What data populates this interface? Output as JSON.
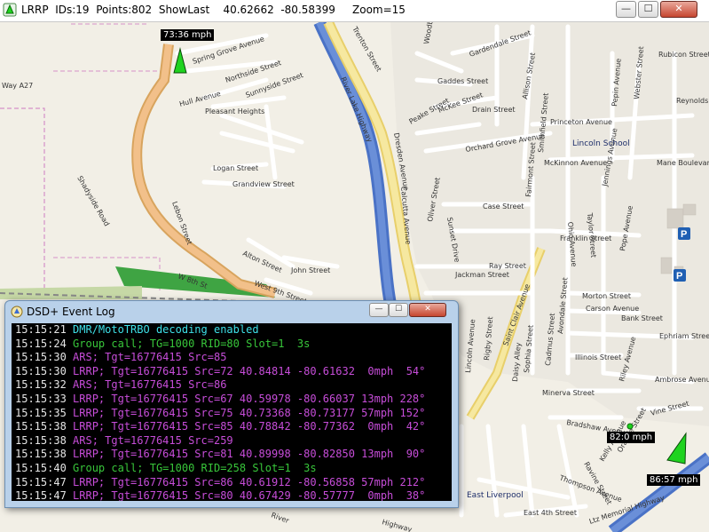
{
  "app": {
    "title": "LRRP  IDs:19  Points:802  ShowLast    40.62662  -80.58399     Zoom=15"
  },
  "titlebar_buttons": {
    "minimize": "—",
    "maximize": "☐",
    "close": "✕"
  },
  "markers": [
    {
      "speed": "73:36 mph",
      "color": "#1fd31f"
    },
    {
      "speed": "82:0 mph",
      "color": "#1fd31f"
    },
    {
      "speed": "86:57 mph",
      "color": "#1fd31f"
    }
  ],
  "map_labels": {
    "streets": [
      "Spring Grove Avenue",
      "Northside Street",
      "Hull Avenue",
      "Sunnyside Street",
      "Pleasant Heights",
      "Logan Street",
      "Grandview Street",
      "Lebon Street",
      "Shadyside Road",
      "Alton Street",
      "John Street",
      "West 9th Street",
      "W 8th St",
      "River Lake Highway",
      "Dresden Avenue",
      "Calcutta Avenue",
      "Trenton Street",
      "Woodbine",
      "Gaddes Street",
      "Gardendale Street",
      "Allison Street",
      "Rubicon Street",
      "Pepin Avenue",
      "Webster Street",
      "Reynolds",
      "Peake Street",
      "McKee Street",
      "Drain Street",
      "Princeton Avenue",
      "Orchard Grove Avenue",
      "Smithfield Street",
      "McKinnon Avenue",
      "Lincoln School",
      "Mane Boulevard",
      "Jennings Avenue",
      "Case Street",
      "Oliver Street",
      "Sunset Drive",
      "Franklin Street",
      "Pope Avenue",
      "Ray Street",
      "Jackman Street",
      "Saint Clair Avenue",
      "Morton Street",
      "Carson Avenue",
      "Bank Street",
      "Ephriam Street",
      "Illinois Street",
      "Minerva Street",
      "Ambrose Avenue",
      "Riley Avenue",
      "Vine Street",
      "Bradshaw Avenue",
      "Lincoln Avenue",
      "Rigby Street",
      "Sophia Street",
      "Daisy Alley",
      "Cadmus Street",
      "Avondale Street",
      "East Liverpool",
      "Ravine Street",
      "Thompson Avenue",
      "East 4th Street",
      "Orange Street",
      "Fairmont Street",
      "Ohio Avenue",
      "Taylor Street",
      "Kelly Avenue",
      "Highway",
      "River"
    ],
    "route": "Way A27",
    "highway_bottom": "Ltz Memorial Highway",
    "parking": "P"
  },
  "event_log": {
    "title": "DSD+ Event Log",
    "lines": [
      {
        "time": "15:15:21",
        "text": "DMR/MotoTRBO decoding enabled",
        "color": "cyan"
      },
      {
        "time": "15:15:24",
        "text": "Group call; TG=1000 RID=80 Slot=1  3s",
        "color": "green"
      },
      {
        "time": "15:15:30",
        "text": "ARS; Tgt=16776415 Src=85",
        "color": "purple"
      },
      {
        "time": "15:15:30",
        "text": "LRRP; Tgt=16776415 Src=72 40.84814 -80.61632  0mph  54°",
        "color": "purple"
      },
      {
        "time": "15:15:32",
        "text": "ARS; Tgt=16776415 Src=86",
        "color": "purple"
      },
      {
        "time": "15:15:33",
        "text": "LRRP; Tgt=16776415 Src=67 40.59978 -80.66037 13mph 228°",
        "color": "purple"
      },
      {
        "time": "15:15:35",
        "text": "LRRP; Tgt=16776415 Src=75 40.73368 -80.73177 57mph 152°",
        "color": "purple"
      },
      {
        "time": "15:15:38",
        "text": "LRRP; Tgt=16776415 Src=85 40.78842 -80.77362  0mph  42°",
        "color": "purple"
      },
      {
        "time": "15:15:38",
        "text": "ARS; Tgt=16776415 Src=259",
        "color": "purple"
      },
      {
        "time": "15:15:38",
        "text": "LRRP; Tgt=16776415 Src=81 40.89998 -80.82850 13mph  90°",
        "color": "purple"
      },
      {
        "time": "15:15:40",
        "text": "Group call; TG=1000 RID=258 Slot=1  3s",
        "color": "green"
      },
      {
        "time": "15:15:47",
        "text": "LRRP; Tgt=16776415 Src=86 40.61912 -80.56858 57mph 212°",
        "color": "purple"
      },
      {
        "time": "15:15:47",
        "text": "LRRP; Tgt=16776415 Src=80 40.67429 -80.57777  0mph  38°",
        "color": "purple"
      }
    ]
  }
}
